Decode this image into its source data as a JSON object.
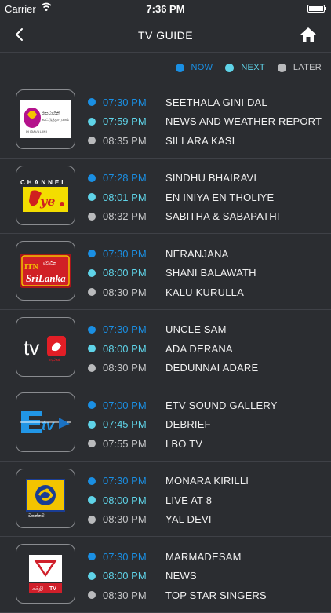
{
  "status_bar": {
    "carrier": "Carrier",
    "time": "7:36 PM"
  },
  "nav": {
    "title": "TV GUIDE",
    "back_icon": "chevron-left-icon",
    "home_icon": "home-icon"
  },
  "legend": [
    {
      "label": "NOW",
      "color": "#1a8fe3"
    },
    {
      "label": "NEXT",
      "color": "#5fd3e8"
    },
    {
      "label": "LATER",
      "color": "#b9babc"
    }
  ],
  "colors": {
    "now": "#1a8fe3",
    "next": "#5fd3e8",
    "later": "#b9babc",
    "background": "#2b2d31"
  },
  "channels": [
    {
      "logo": "rupavahini-logo",
      "logo_text": "රූපවාහිනී",
      "programs": [
        {
          "time": "07:30 PM",
          "name": "SEETHALA GINI DAL"
        },
        {
          "time": "07:59 PM",
          "name": "NEWS AND WEATHER REPORT"
        },
        {
          "time": "08:35 PM",
          "name": "SILLARA KASI"
        }
      ]
    },
    {
      "logo": "channel-eye-logo",
      "logo_text": "CHANNEL Eye",
      "programs": [
        {
          "time": "07:28 PM",
          "name": "SINDHU BHAIRAVI"
        },
        {
          "time": "08:01 PM",
          "name": "EN INIYA EN THOLIYE"
        },
        {
          "time": "08:32 PM",
          "name": "SABITHA & SABAPATHI"
        }
      ]
    },
    {
      "logo": "itn-logo",
      "logo_text": "ITN Sri Lanka",
      "programs": [
        {
          "time": "07:30 PM",
          "name": "NERANJANA"
        },
        {
          "time": "08:00 PM",
          "name": "SHANI BALAWATH"
        },
        {
          "time": "08:30 PM",
          "name": "KALU KURULLA"
        }
      ]
    },
    {
      "logo": "tv-derana-logo",
      "logo_text": "tv",
      "programs": [
        {
          "time": "07:30 PM",
          "name": "UNCLE SAM"
        },
        {
          "time": "08:00 PM",
          "name": "ADA DERANA"
        },
        {
          "time": "08:30 PM",
          "name": "DEDUNNAI ADARE"
        }
      ]
    },
    {
      "logo": "etv-logo",
      "logo_text": "Etv",
      "programs": [
        {
          "time": "07:00 PM",
          "name": "ETV SOUND GALLERY"
        },
        {
          "time": "07:45 PM",
          "name": "DEBRIEF"
        },
        {
          "time": "07:55 PM",
          "name": "LBO TV"
        }
      ]
    },
    {
      "logo": "vasantham-logo",
      "logo_text": "",
      "programs": [
        {
          "time": "07:30 PM",
          "name": "MONARA KIRILLI"
        },
        {
          "time": "08:00 PM",
          "name": "LIVE AT 8"
        },
        {
          "time": "08:30 PM",
          "name": "YAL DEVI"
        }
      ]
    },
    {
      "logo": "shakthi-tv-logo",
      "logo_text": "TV",
      "programs": [
        {
          "time": "07:30 PM",
          "name": "MARMADESAM"
        },
        {
          "time": "08:00 PM",
          "name": "NEWS"
        },
        {
          "time": "08:30 PM",
          "name": "TOP STAR SINGERS"
        }
      ]
    }
  ]
}
